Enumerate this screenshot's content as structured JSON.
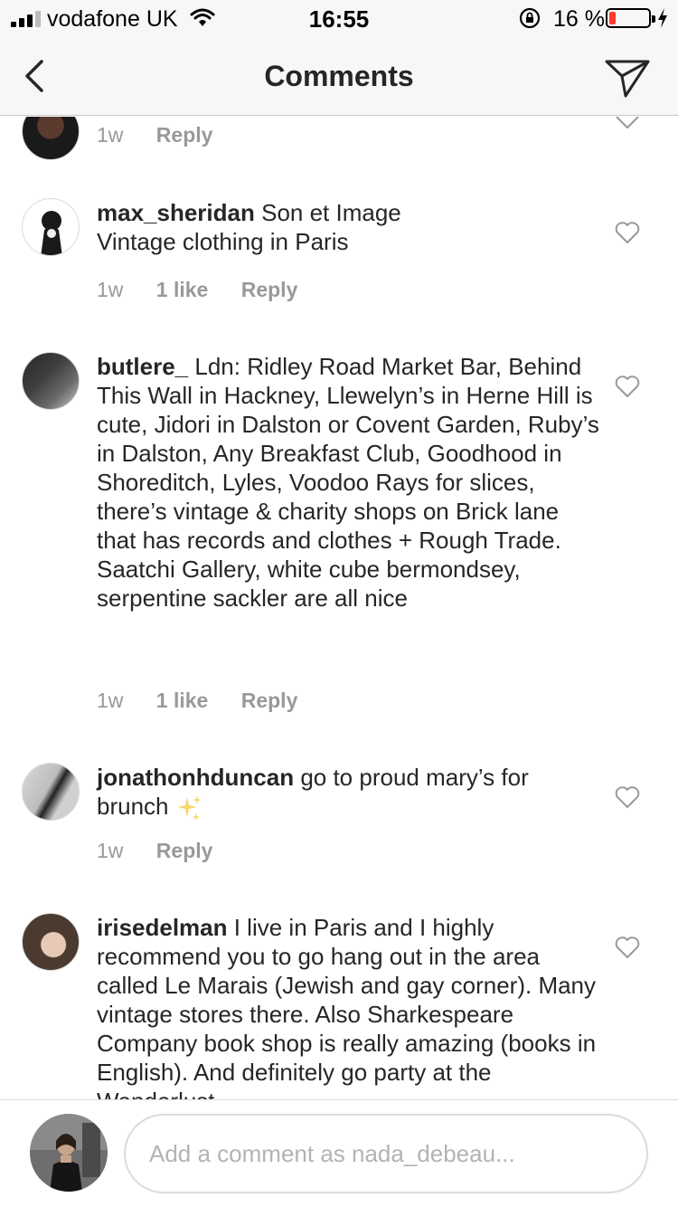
{
  "status_bar": {
    "carrier": "vodafone UK",
    "time": "16:55",
    "battery_percent": "16 %",
    "battery_level": 0.16,
    "battery_color": "#ff3b30"
  },
  "nav": {
    "title": "Comments",
    "back_icon": "chevron-left-icon",
    "send_icon": "paper-plane-icon"
  },
  "comments": [
    {
      "time": "1w",
      "reply": "Reply"
    },
    {
      "username": "max_sheridan",
      "text": " Son et Image\nVintage clothing in Paris",
      "time": "1w",
      "likes": "1 like",
      "reply": "Reply"
    },
    {
      "username": "butlere_",
      "text": " Ldn: Ridley Road Market Bar, Behind This Wall in Hackney, Llewelyn’s in Herne Hill is cute, Jidori in Dalston or Covent Garden, Ruby’s in Dalston, Any Breakfast Club, Goodhood in Shoreditch, Lyles, Voodoo Rays for slices, there’s vintage & charity shops on Brick lane that has records and clothes + Rough Trade. Saatchi Gallery, white cube bermondsey, serpentine sackler are all nice",
      "time": "1w",
      "likes": "1 like",
      "reply": "Reply"
    },
    {
      "username": "jonathonhduncan",
      "text": " go to proud mary’s for brunch",
      "emoji": "sparkles-icon",
      "time": "1w",
      "reply": "Reply"
    },
    {
      "username": "irisedelman",
      "text": " I live in Paris and I highly recommend you to go hang out in the area called Le Marais (Jewish and gay corner). Many vintage stores there. Also Sharkespeare Company book shop is really amazing (books in English). And definitely go party at the Wanderlust"
    }
  ],
  "input": {
    "placeholder": "Add a comment as nada_debeau..."
  }
}
